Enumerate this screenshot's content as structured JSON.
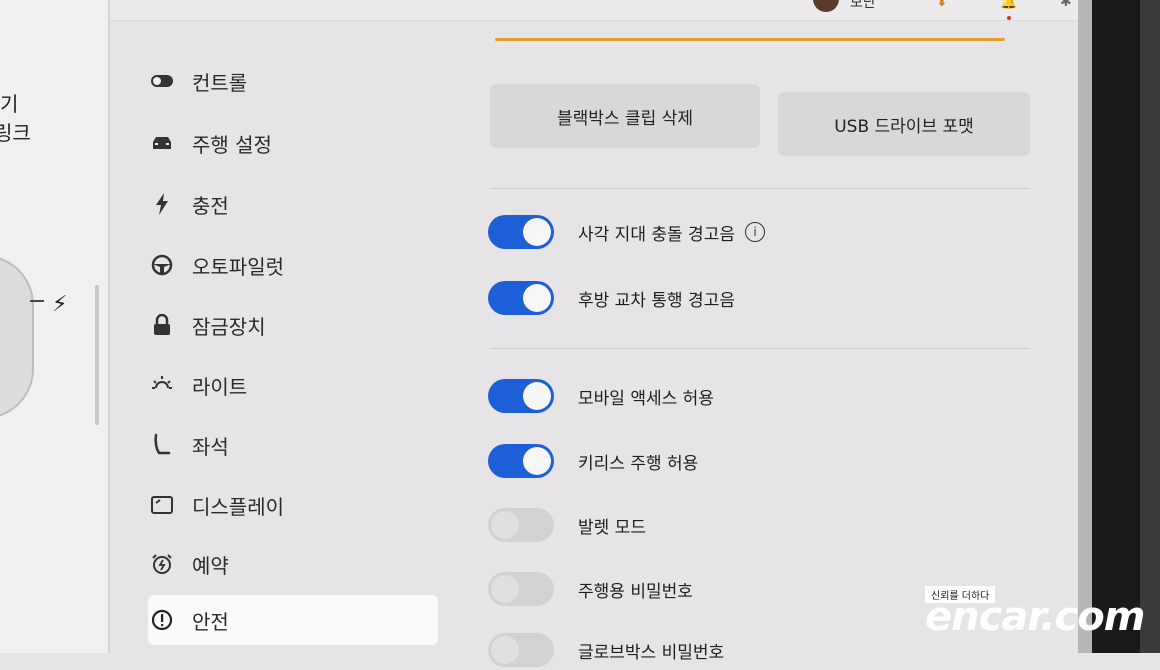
{
  "car_panel": {
    "partial_lines": [
      "기",
      "링크"
    ]
  },
  "topbar": {
    "name": "보단"
  },
  "sidebar": {
    "items": [
      {
        "label": "컨트롤",
        "icon": "toggle-icon",
        "selected": false
      },
      {
        "label": "주행 설정",
        "icon": "car-icon",
        "selected": false
      },
      {
        "label": "충전",
        "icon": "bolt-icon",
        "selected": false
      },
      {
        "label": "오토파일럿",
        "icon": "steering-wheel-icon",
        "selected": false
      },
      {
        "label": "잠금장치",
        "icon": "lock-icon",
        "selected": false
      },
      {
        "label": "라이트",
        "icon": "sun-icon",
        "selected": false
      },
      {
        "label": "좌석",
        "icon": "seat-icon",
        "selected": false
      },
      {
        "label": "디스플레이",
        "icon": "display-icon",
        "selected": false
      },
      {
        "label": "예약",
        "icon": "alarm-clock-icon",
        "selected": false
      },
      {
        "label": "안전",
        "icon": "alert-circle-icon",
        "selected": true
      }
    ]
  },
  "main": {
    "buttons": {
      "delete_clips": "블랙박스 클립 삭제",
      "format_usb": "USB 드라이브 포맷"
    },
    "toggles": [
      {
        "label": "사각 지대 충돌 경고음",
        "on": true,
        "info": true
      },
      {
        "label": "후방 교차 통행 경고음",
        "on": true,
        "info": false
      },
      {
        "label": "모바일 액세스 허용",
        "on": true,
        "info": false
      },
      {
        "label": "키리스 주행 허용",
        "on": true,
        "info": false
      },
      {
        "label": "발렛 모드",
        "on": false,
        "info": false
      },
      {
        "label": "주행용 비밀번호",
        "on": false,
        "info": false
      },
      {
        "label": "글로브박스 비밀번호",
        "on": false,
        "info": false
      }
    ]
  },
  "watermark": {
    "tagline": "신뢰를 더하다",
    "logo": "encar.com"
  },
  "colors": {
    "toggle_on": "#1c5fd6",
    "accent_line": "#e6a030"
  }
}
